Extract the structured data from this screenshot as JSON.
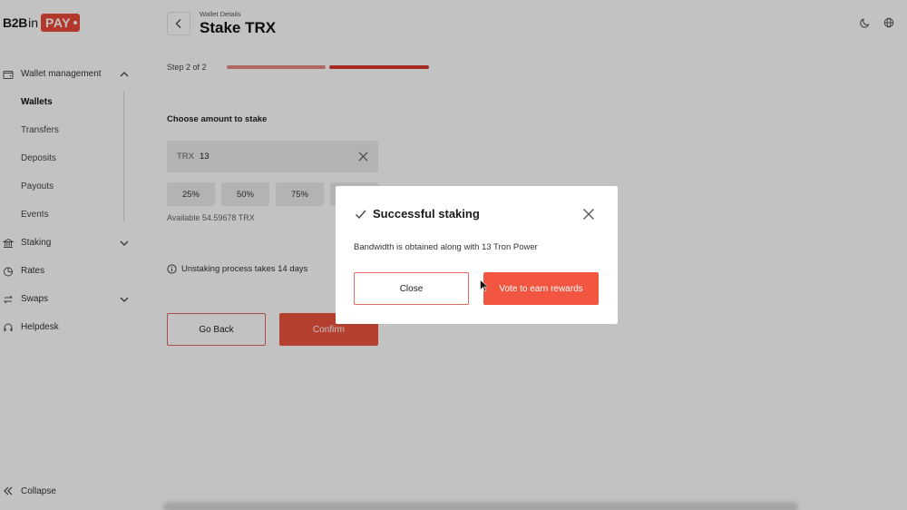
{
  "brand": {
    "b2b": "B2B",
    "in": "in",
    "pay": "PAY",
    "accent": "#ea4a3b"
  },
  "sidebar": {
    "wallet_management": "Wallet management",
    "sub_items": [
      "Wallets",
      "Transfers",
      "Deposits",
      "Payouts",
      "Events"
    ],
    "active_sub": "Wallets",
    "staking": "Staking",
    "rates": "Rates",
    "swaps": "Swaps",
    "helpdesk": "Helpdesk",
    "collapse": "Collapse"
  },
  "header": {
    "breadcrumb": "Wallet Details",
    "title": "Stake TRX"
  },
  "steps": {
    "label": "Step 2 of 2",
    "current": 2,
    "total": 2
  },
  "form": {
    "section_title": "Choose amount to stake",
    "currency": "TRX",
    "amount": "13",
    "percent_buttons": [
      "25%",
      "50%",
      "75%"
    ],
    "available": "Available 54.59678 TRX",
    "info": "Unstaking process takes 14 days",
    "go_back": "Go Back",
    "confirm": "Confirm"
  },
  "modal": {
    "title": "Successful staking",
    "message": "Bandwidth is obtained along with 13 Tron Power",
    "close_label": "Close",
    "vote_label": "Vote to earn rewards"
  },
  "icons": {
    "wallet": "wallet-icon",
    "staking": "bank-icon",
    "rates": "pie-chart-icon",
    "swaps": "swap-icon",
    "helpdesk": "headset-icon",
    "theme": "moon-icon",
    "language": "globe-icon"
  }
}
